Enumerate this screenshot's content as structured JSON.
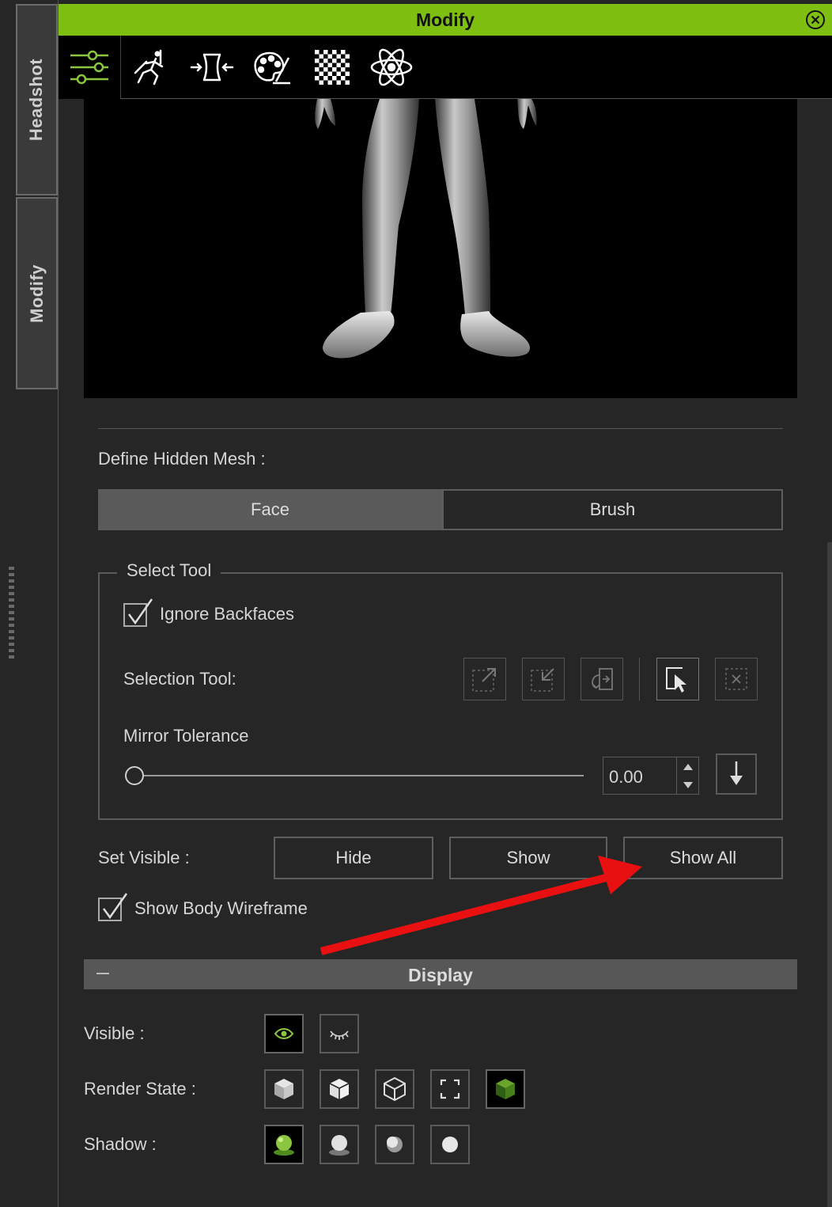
{
  "side_tabs": {
    "headshot": "Headshot",
    "modify": "Modify"
  },
  "title_bar": {
    "title": "Modify",
    "accent_color": "#7fbf12"
  },
  "toolbar": {
    "tools": [
      {
        "name": "settings-sliders",
        "active": true
      },
      {
        "name": "motion-pose"
      },
      {
        "name": "morph"
      },
      {
        "name": "material-palette"
      },
      {
        "name": "texture-checker"
      },
      {
        "name": "physics-atom"
      }
    ]
  },
  "hidden_mesh": {
    "label": "Define Hidden Mesh :",
    "tabs": [
      {
        "label": "Face",
        "active": true
      },
      {
        "label": "Brush",
        "active": false
      }
    ]
  },
  "select_tool": {
    "legend": "Select Tool",
    "ignore_backfaces": {
      "label": "Ignore Backfaces",
      "checked": true
    },
    "selection_tool_label": "Selection Tool:",
    "mirror_tolerance": {
      "label": "Mirror Tolerance",
      "value": "0.00",
      "slider_fraction": 0
    }
  },
  "set_visible": {
    "label": "Set Visible :",
    "hide": "Hide",
    "show": "Show",
    "show_all": "Show All"
  },
  "show_body_wireframe": {
    "label": "Show Body Wireframe",
    "checked": true
  },
  "display": {
    "title": "Display",
    "visible_label": "Visible :",
    "render_state_label": "Render State  :",
    "shadow_label": "Shadow :"
  },
  "annotation": {
    "color": "#e81010"
  }
}
